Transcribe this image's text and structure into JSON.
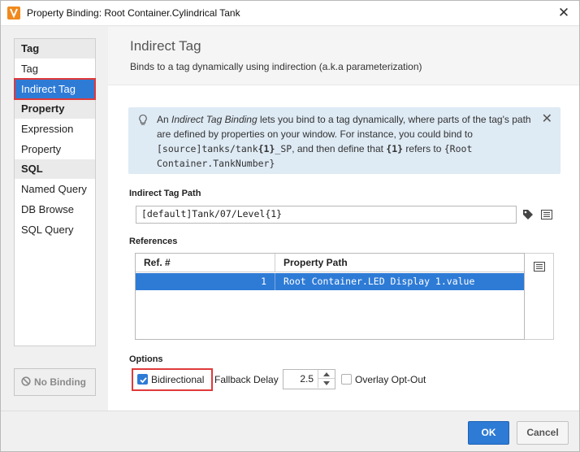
{
  "window": {
    "title": "Property Binding: Root Container.Cylindrical Tank",
    "close": "✕"
  },
  "sidebar": {
    "groups": [
      {
        "label": "Tag",
        "items": [
          "Tag",
          "Indirect Tag"
        ]
      },
      {
        "label": "Property",
        "items": [
          "Expression",
          "Property"
        ]
      },
      {
        "label": "SQL",
        "items": [
          "Named Query",
          "DB Browse",
          "SQL Query"
        ]
      }
    ],
    "selected": "Indirect Tag",
    "no_binding": "No Binding"
  },
  "header": {
    "title": "Indirect Tag",
    "subtitle": "Binds to a tag dynamically using indirection (a.k.a parameterization)"
  },
  "info": {
    "t1": "An ",
    "t2": "Indirect Tag Binding",
    "t3": " lets you bind to a tag dynamically, where parts of the tag's path are defined by properties on your window. For instance, you could bind to ",
    "t4": "[source]tanks/tank",
    "t5": "{1}",
    "t6": "_SP",
    "t7": ", and then define that ",
    "t8": "{1}",
    "t9": " refers to ",
    "t10": "{Root Container.TankNumber}",
    "close": "✕"
  },
  "tag_path": {
    "label": "Indirect Tag Path",
    "value": "[default]Tank/07/Level{1}"
  },
  "references": {
    "label": "References",
    "columns": [
      "Ref. #",
      "Property Path"
    ],
    "rows": [
      {
        "ref": "1",
        "path": "Root Container.LED Display 1.value"
      }
    ]
  },
  "options": {
    "label": "Options",
    "bidirectional": "Bidirectional",
    "bidirectional_checked": true,
    "fallback_label": "Fallback Delay",
    "fallback_value": "2.5",
    "overlay_label": "Overlay Opt-Out",
    "overlay_checked": false
  },
  "footer": {
    "ok": "OK",
    "cancel": "Cancel"
  },
  "colors": {
    "accent": "#2e7bd6",
    "highlight_border": "#e03a3a",
    "info_bg": "#deeaf4"
  }
}
